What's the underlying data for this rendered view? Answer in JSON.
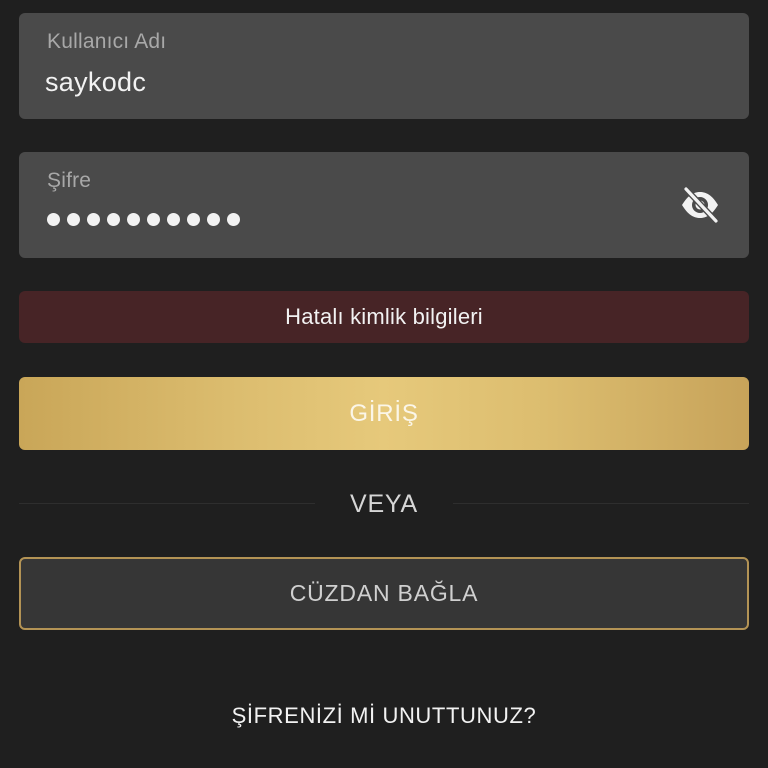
{
  "username": {
    "label": "Kullanıcı Adı",
    "value": "saykodc"
  },
  "password": {
    "label": "Şifre",
    "masked_length": 10,
    "toggle_icon": "eye-off-icon"
  },
  "error": {
    "message": "Hatalı kimlik bilgileri"
  },
  "actions": {
    "login_label": "GİRİŞ",
    "or_label": "VEYA",
    "wallet_label": "CÜZDAN BAĞLA",
    "forgot_label": "ŞİFRENİZİ Mİ UNUTTUNUZ?"
  },
  "colors": {
    "background": "#1f1f1f",
    "field": "#4a4a4a",
    "error_bg": "#472426",
    "gold": "#dcbd6f",
    "wallet_border": "#b39355"
  }
}
